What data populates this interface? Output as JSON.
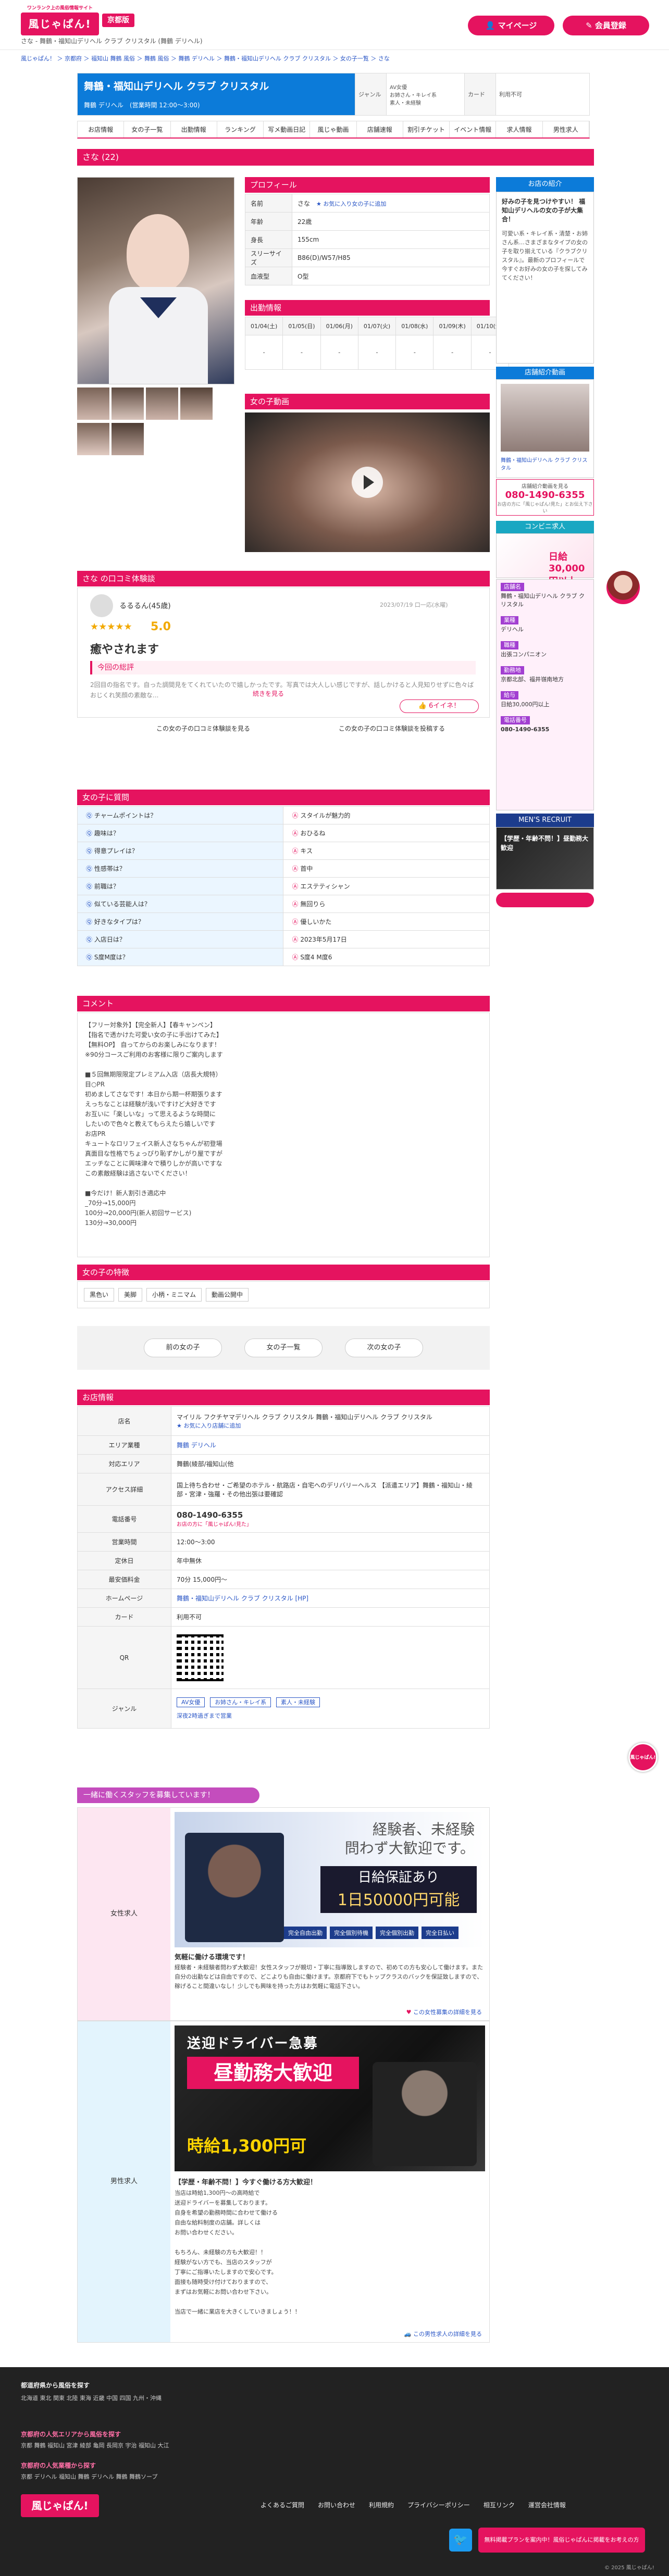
{
  "header": {
    "logo_text": "風じゃぱん!",
    "logo_sub": "ワンランク上の風俗情報サイト",
    "area": "京都版",
    "subtitle": "さな - 舞鶴・福知山デリヘル クラブ クリスタル (舞鶴 デリヘル)",
    "mypage_btn": "マイページ",
    "register_btn": "会員登録"
  },
  "breadcrumb": "風じゃぱん！ ＞ 京都府 ＞ 福知山 舞鶴 風俗 ＞ 舞鶴 風俗 ＞ 舞鶴 デリヘル ＞ 舞鶴・福知山デリヘル クラブ クリスタル ＞ 女の子一覧 ＞ さな",
  "shop": {
    "name": "舞鶴・福知山デリヘル クラブ クリスタル",
    "info": "舞鶴 デリヘル　(営業時間 12:00〜3:00)",
    "genre_label": "ジャンル",
    "genre_values": [
      "AV女優",
      "お姉さん・キレイ系",
      "素人・未経験"
    ],
    "card_label": "カード",
    "card_value": "利用不可"
  },
  "tabs": [
    "お店情報",
    "女の子一覧",
    "出勤情報",
    "ランキング",
    "写メ動画日記",
    "風じゃ動画",
    "店舗速報",
    "割引チケット",
    "イベント情報",
    "求人情報",
    "男性求人"
  ],
  "girl_header": {
    "name": "さな",
    "age": "(22)"
  },
  "profile": {
    "header": "プロフィール",
    "rows": [
      {
        "k": "名前",
        "v": "さな",
        "link": "★ お気に入り女の子に追加"
      },
      {
        "k": "年齢",
        "v": "22歳"
      },
      {
        "k": "身長",
        "v": "155cm"
      },
      {
        "k": "スリーサイズ",
        "v": "B86(D)/W57/H85"
      },
      {
        "k": "血液型",
        "v": "O型"
      }
    ]
  },
  "schedule": {
    "header": "出勤情報",
    "days": [
      "01/04(土)",
      "01/05(日)",
      "01/06(月)",
      "01/07(火)",
      "01/08(水)",
      "01/09(木)",
      "01/10(金)"
    ],
    "values": [
      "-",
      "-",
      "-",
      "-",
      "-",
      "-",
      "-"
    ]
  },
  "video_header": "女の子動画",
  "review": {
    "header": "さな の口コミ体験談",
    "user": "るるるん(45歳)",
    "date": "2023/07/19 口一応(水曜)",
    "stars": "★★★★★",
    "score": "5.0",
    "title": "癒やされます",
    "tag": "今回の総評",
    "body": "2回目の指名です。自った調間見をてくれていたので嬉しかったです。写真では大人しい感じですが、話しかけると人見知りせずに色々ばおじくれ笑顔の素敵な...",
    "more": "続きを見る",
    "like": "6イイネ！",
    "list_link": "この女の子の口コミ体験談を見る",
    "post_link": "この女の子の口コミ体験談を投稿する"
  },
  "qa": {
    "header": "女の子に質問",
    "rows": [
      {
        "q": "チャームポイントは？",
        "a": "スタイルが魅力的"
      },
      {
        "q": "趣味は？",
        "a": "おひるね"
      },
      {
        "q": "得意プレイは？",
        "a": "キス"
      },
      {
        "q": "性感帯は？",
        "a": "首中"
      },
      {
        "q": "前職は？",
        "a": "エステティシャン"
      },
      {
        "q": "似ている芸能人は？",
        "a": "無回りら"
      },
      {
        "q": "好きなタイプは？",
        "a": "優しいかた"
      },
      {
        "q": "入店日は？",
        "a": "2023年5月17日"
      },
      {
        "q": "S度M度は？",
        "a": "S度4 M度6"
      }
    ]
  },
  "comment": {
    "header": "コメント",
    "lines": [
      "【フリー対象外】【完全新人】【春キャンペン】",
      "【指名で透かけた可愛い女の子に手出けてみた】",
      "【無料OP】 自ってからのお楽しみになります！",
      "※90分コースご利用のお客様に限りご案内します",
      "",
      "■５回無期限限定プレミアム入店（店長大規特）",
      "目○PR",
      "初めましてさなです！本日から期一杯期張ります",
      "えっちなことは経験が浅いですけど大好きです",
      "お互いに「楽しいな」って思えるような時間に",
      "したいので色々と教えてもらえたら嬉しいです",
      "お店PR",
      "キュートなロリフェイス新人さなちゃんが初登場",
      "真面目な性格でちょっぴり恥ずかしがり屋ですが",
      "エッチなことに興味津々で積りしかが高いですな",
      "この素敵経験は逃さないでください！",
      "",
      "■今だけ！新人割引き適応中",
      "_70分→15,000円",
      "100分→20,000円(新人初回サービス)",
      "130分→30,000円"
    ]
  },
  "features": {
    "header": "女の子の特徴",
    "tags": [
      "黒色い",
      "美脚",
      "小柄・ミニマム",
      "動画公開中"
    ]
  },
  "nav": {
    "prev": "前の女の子",
    "list": "女の子一覧",
    "next": "次の女の子"
  },
  "shopinfo": {
    "header": "お店情報",
    "rows": [
      {
        "k": "店名",
        "v": "マイリル フクチヤマデリヘル クラブ クリスタル 舞鶴・福知山デリヘル クラブ クリスタル",
        "link": "★ お気に入り店舗に追加"
      },
      {
        "k": "エリア業種",
        "v": "舞鶴 デリヘル"
      },
      {
        "k": "対応エリア",
        "v": "舞鶴(綾部/福知山(他"
      },
      {
        "k": "アクセス詳細",
        "v": "国上待ち合わせ・ご希望のホテル・航路店・自宅へのデリバリーヘルス 【派遣エリア】舞鶴・福知山・綾部・宮津・強羅・その他出張は要確認"
      },
      {
        "k": "電話番号",
        "v": "080-1490-6355",
        "sub": "お店の方に「風じゃぱん!見た」"
      },
      {
        "k": "営業時間",
        "v": "12:00〜3:00"
      },
      {
        "k": "定休日",
        "v": "年中無休"
      },
      {
        "k": "最安価料金",
        "v": "70分 15,000円〜"
      },
      {
        "k": "ホームページ",
        "v": "舞鶴・福知山デリヘル クラブ クリスタル [HP]"
      },
      {
        "k": "カード",
        "v": "利用不可"
      },
      {
        "k": "QR",
        "v": ""
      },
      {
        "k": "ジャンル",
        "v": "",
        "tags": [
          "AV女優",
          "お姉さん・キレイ系",
          "素人・未経験"
        ],
        "sub": "深夜2時過ぎまで営業"
      }
    ]
  },
  "recruit": {
    "header": "一緒に働くスタッフを募集しています！",
    "women_label": "女性求人",
    "women_banner_lines": [
      "経験者、未経験",
      "問わず大歓迎です。",
      "日給保証あり",
      "1日50000円可能"
    ],
    "women_chips": [
      "完全自由出勤",
      "完全個別待機",
      "完全個別出勤",
      "完全日払い"
    ],
    "women_title": "気軽に働ける環境です！",
    "women_body": "経験者・未経験者問わず大歓迎！女性スタッフが親切・丁寧に指導致しますので、初めての方も安心して働けます。また自分の出勤などは自由ですので、どこよりも自由に働けます。京都府下でもトップクラスのバックを保証致しますので、稼げること間違いなし！少しでも興味を持った方はお気軽に電話下さい。",
    "women_link": "この女性募集の詳細を見る",
    "men_label": "男性求人",
    "men_banner_lines": [
      "送迎ドライバー急募",
      "昼勤務大歓迎",
      "時給1,300円可"
    ],
    "men_title": "【学歴・年齢不問！】今すぐ働ける方大歓迎！",
    "men_body": "当店は時給1,300円〜の高時給で\n送迎ドライバーを募集しております。\n自身を希望の勤務時間に合わせて働ける\n自由な給料制度の店舗。詳しくは\nお問い合わせください。\n\nもちろん、未経験の方も大歓迎！！\n経験がない方でも、当店のスタッフが\n丁寧にご指導いたしますので安心です。\n面接も随時受け付けておりますので、\nまずはお気軽にお問い合わせ下さい。\n\n当店で一緒に業店を大きくしていきましょう！！",
    "men_link": "この男性求人の詳細を見る"
  },
  "sidebar": {
    "shop_intro_header": "お店の紹介",
    "shop_intro_lead": "好みの子を見つけやすい！ 福知山デリヘルの女の子が大集合！",
    "shop_intro_body": "可愛い系・キレイ系・清楚・お姉さん系…さまざまなタイプの女の子を取り揃えている『クラブクリスタル』。最新のプロフィールで今すぐお好みの女の子を探してみてください！",
    "staff_video_header": "店舗紹介動画",
    "staff_video_caption": "舞鶴・福知山デリヘル クラブ クリスタル",
    "phone_label": "店舗紹介動画を見る",
    "phone": "080-1490-6355",
    "phone_sub": "お店の方に「風じゃぱん!見た」とお伝え下さい",
    "conbini_header": "コンビニ求人",
    "conbini_rows": [
      {
        "head": "店舗名",
        "val": "舞鶴・福知山デリヘル クラブ クリスタル"
      },
      {
        "head": "業種",
        "val": "デリヘル"
      },
      {
        "head": "職種",
        "val": "出張コンパニオン"
      },
      {
        "head": "勤務地",
        "val": "京都北部、福井嶺南地方"
      },
      {
        "head": "給与",
        "val": "日給30,000円以上"
      },
      {
        "head": "電話番号",
        "val": "080-1490-6355"
      }
    ],
    "men_recruit_header": "MEN'S RECRUIT",
    "men_recruit_banner": "【学歴・年齢不問！】昼勤務大歓迎",
    "men_recruit_btn": ""
  },
  "footer": {
    "heading1": "都道府県から風俗を探す",
    "heading2": "京都府の人気エリアから風俗を探す",
    "heading3": "京都府の人気業種から探す",
    "area_links": "北海道 東北 関東 北陸 東海 近畿 中国 四国 九州・沖縄",
    "kyoto_links": "京都 舞鶴 福知山 宮津 綾部 亀岡 長岡京 宇治 福知山 大江",
    "genre_links": "京都 デリヘル 福知山 舞鶴 デリヘル 舞鶴 舞鶴ソープ",
    "bottom_links": [
      "よくあるご質問",
      "お問い合わせ",
      "利用規約",
      "プライバシーポリシー",
      "相互リンク",
      "運営会社情報"
    ],
    "pr_btn": "無料掲載プランを案内中！風俗じゃぱんに掲載をお考えの方",
    "copyright": "© 2025 風じゃぱん!"
  }
}
